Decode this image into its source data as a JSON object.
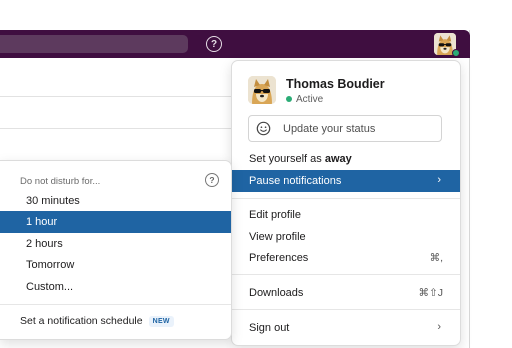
{
  "topbar": {
    "help_icon": "question-circle-icon",
    "help_glyph": "?",
    "avatar_icon": "doge-sunglasses-avatar",
    "presence": "active"
  },
  "profile_menu": {
    "name": "Thomas Boudier",
    "status": "Active",
    "status_placeholder": "Update your status",
    "status_icon": "smile-icon",
    "away_prefix": "Set yourself as ",
    "away_word": "away",
    "pause_label": "Pause notifications",
    "pause_chevron": "›",
    "edit_profile": "Edit profile",
    "view_profile": "View profile",
    "preferences": "Preferences",
    "preferences_shortcut": "⌘,",
    "downloads": "Downloads",
    "downloads_shortcut": "⌘⇧J",
    "sign_out": "Sign out",
    "sign_out_chevron": "›"
  },
  "dnd_submenu": {
    "header": "Do not disturb for...",
    "help_glyph": "?",
    "options": [
      "30 minutes",
      "1 hour",
      "2 hours",
      "Tomorrow",
      "Custom..."
    ],
    "selected": "1 hour",
    "schedule_label": "Set a notification schedule",
    "new_badge": "NEW"
  },
  "colors": {
    "topbar": "#3f0e40",
    "highlight": "#1f64a3",
    "presence": "#2bac76"
  }
}
